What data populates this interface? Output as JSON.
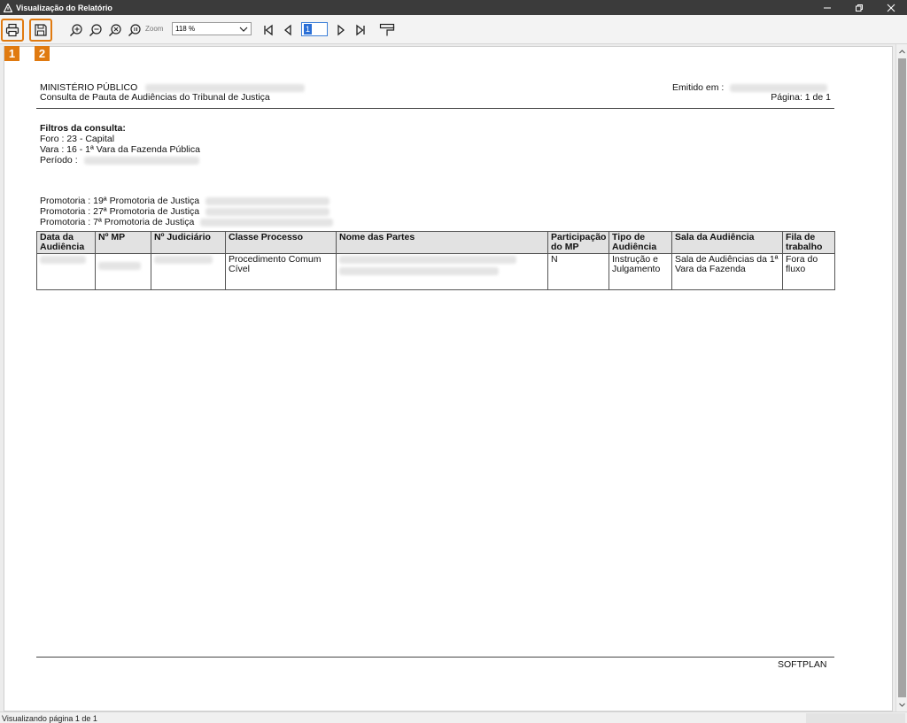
{
  "window": {
    "title": "Visualização do Relatório"
  },
  "toolbar": {
    "zoom_label": "Zoom",
    "zoom_value": "118 %",
    "current_page": "1",
    "callouts": [
      "1",
      "2"
    ]
  },
  "report": {
    "org": "MINISTÉRIO PÚBLICO",
    "subtitle": "Consulta de Pauta de Audiências do Tribunal de Justiça",
    "emitted_label": "Emitido em :",
    "page_label": "Página: 1 de 1",
    "filters_title": "Filtros da consulta:",
    "filters": {
      "foro": "Foro : 23 - Capital",
      "vara": "Vara : 16 - 1ª Vara da Fazenda Pública",
      "periodo": "Período :"
    },
    "promotorias": [
      "Promotoria : 19ª Promotoria de Justiça",
      "Promotoria : 27ª Promotoria de Justiça",
      "Promotoria : 7ª Promotoria de Justiça"
    ],
    "table": {
      "headers": [
        "Data da Audiência",
        "Nº MP",
        "Nº Judiciário",
        "Classe Processo",
        "Nome das Partes",
        "Participação do MP",
        "Tipo de Audiência",
        "Sala da Audiência",
        "Fila de trabalho"
      ],
      "rows": [
        {
          "classe": "Procedimento Comum Cível",
          "participacao": "N",
          "tipo": "Instrução e Julgamento",
          "sala": "Sala de Audiências da 1ª Vara da Fazenda",
          "fila": "Fora do fluxo"
        }
      ]
    },
    "footer": "SOFTPLAN"
  },
  "status": {
    "text": "Visualizando página 1 de 1"
  },
  "colors": {
    "titlebar": "#3b3b3b",
    "accent": "#e07a10",
    "header_bg": "#e2e2e2"
  }
}
